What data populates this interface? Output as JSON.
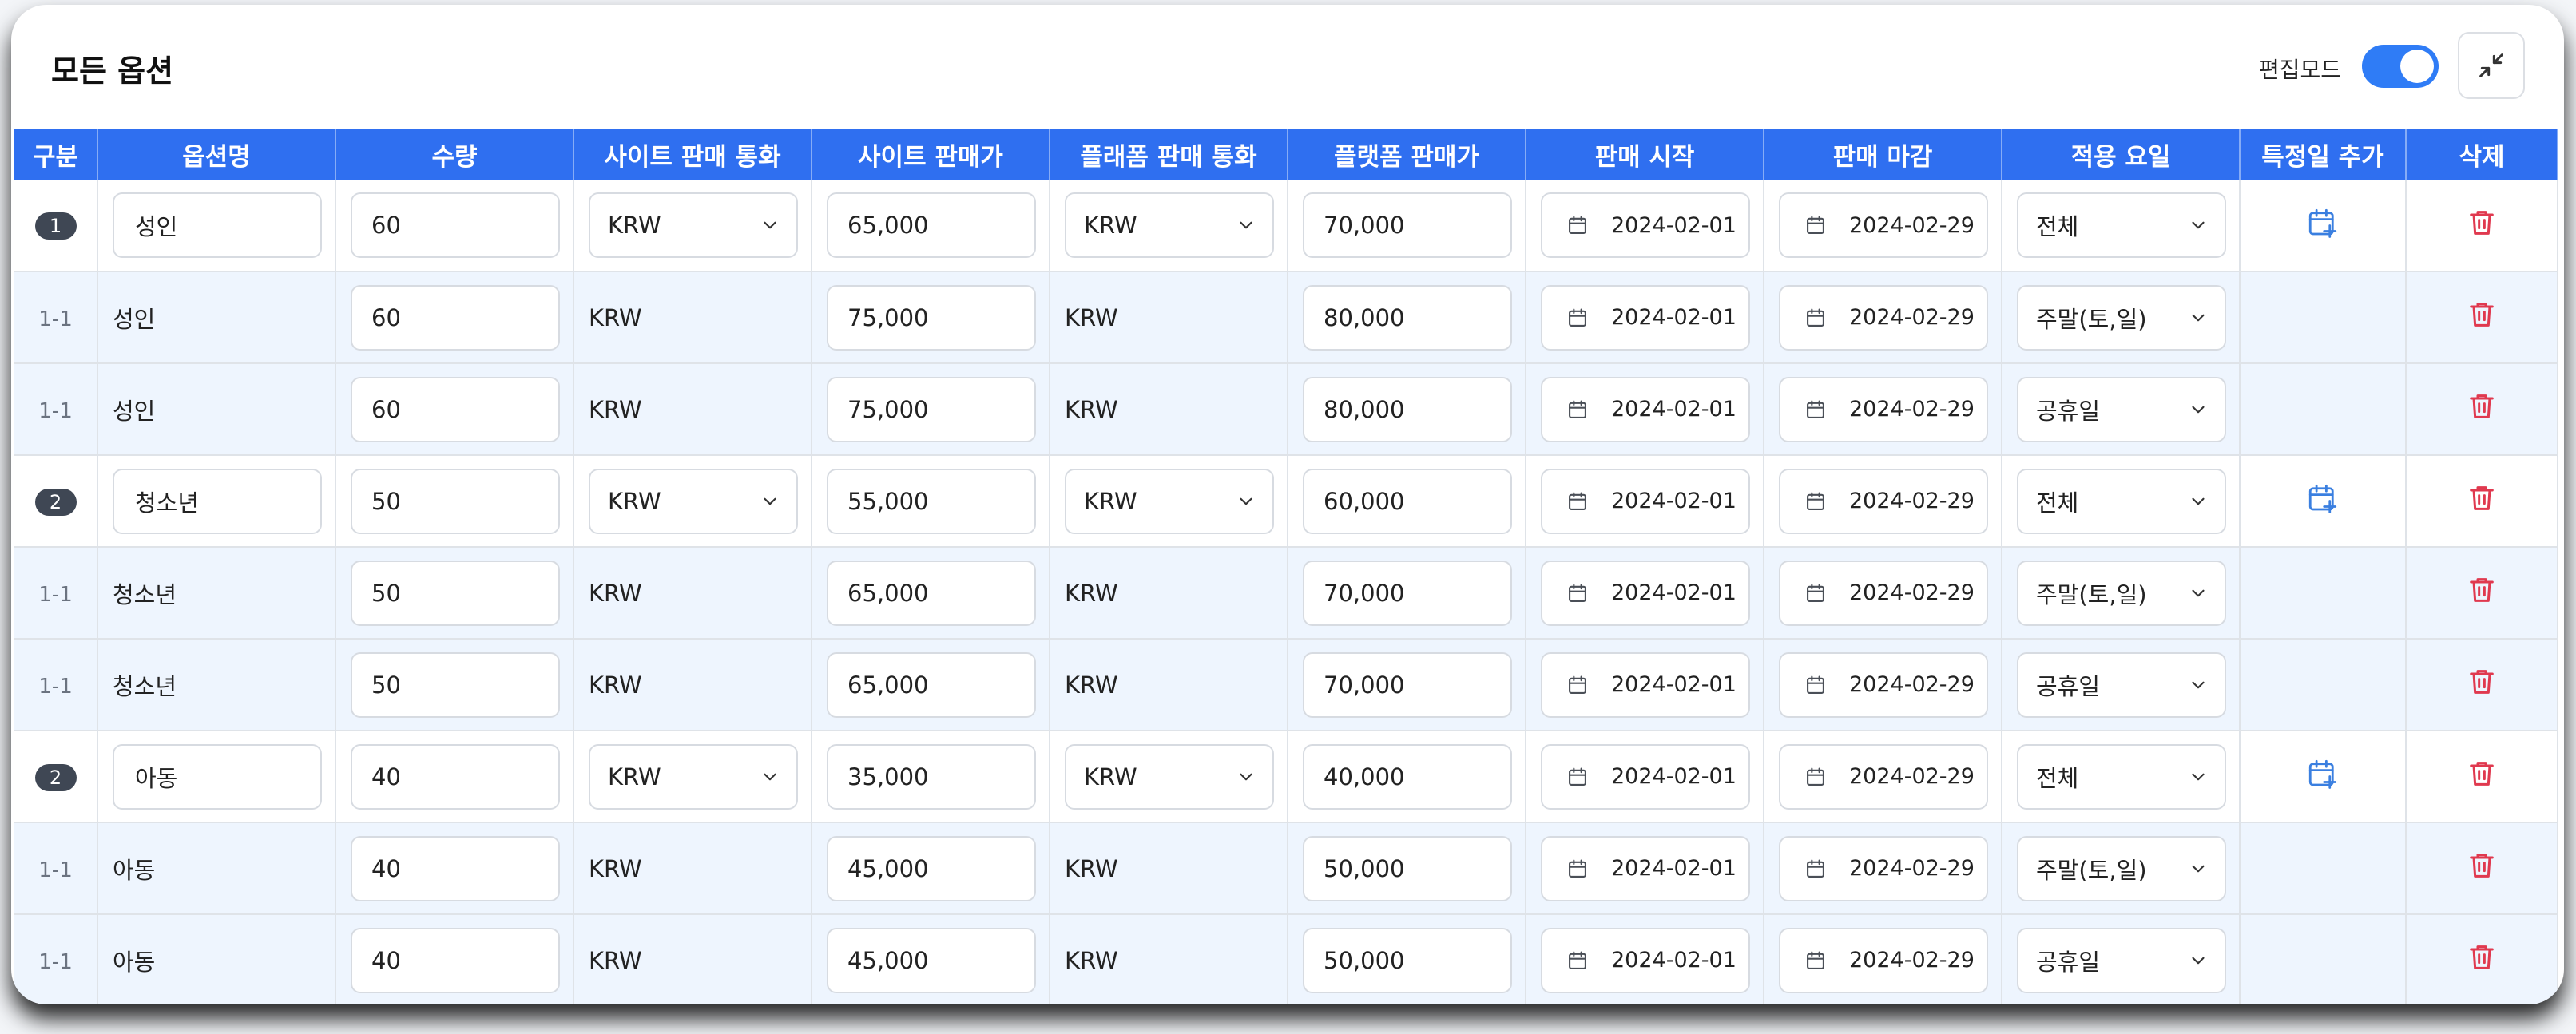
{
  "header": {
    "title": "모든 옵션",
    "edit_mode_label": "편집모드",
    "edit_mode_on": true
  },
  "colors": {
    "accent": "#2f6ff0",
    "header_bg": "#2f6ff0",
    "sub_row_bg": "#eef5fe",
    "delete_icon": "#e0394f",
    "add_date_icon": "#3a7fe0",
    "badge_bg": "#3f4754"
  },
  "icons": {
    "collapse": "minimize-arrows-icon",
    "calendar": "calendar-icon",
    "add_date": "calendar-plus-icon",
    "delete": "trash-icon",
    "dropdown": "chevron-down-icon"
  },
  "columns": [
    "구분",
    "옵션명",
    "수량",
    "사이트 판매 통화",
    "사이트 판매가",
    "플래폼 판매 통화",
    "플랫폼 판매가",
    "판매 시작",
    "판매 마감",
    "적용 요일",
    "특정일 추가",
    "삭제"
  ],
  "rows": [
    {
      "type": "main",
      "idx": "1",
      "name": "성인",
      "qty": "60",
      "site_currency": "KRW",
      "site_price": "65,000",
      "platform_currency": "KRW",
      "platform_price": "70,000",
      "start": "2024-02-01",
      "end": "2024-02-29",
      "days": "전체"
    },
    {
      "type": "sub",
      "idx": "1-1",
      "name": "성인",
      "qty": "60",
      "site_currency": "KRW",
      "site_price": "75,000",
      "platform_currency": "KRW",
      "platform_price": "80,000",
      "start": "2024-02-01",
      "end": "2024-02-29",
      "days": "주말(토,일)"
    },
    {
      "type": "sub",
      "idx": "1-1",
      "name": "성인",
      "qty": "60",
      "site_currency": "KRW",
      "site_price": "75,000",
      "platform_currency": "KRW",
      "platform_price": "80,000",
      "start": "2024-02-01",
      "end": "2024-02-29",
      "days": "공휴일"
    },
    {
      "type": "main",
      "idx": "2",
      "name": "청소년",
      "qty": "50",
      "site_currency": "KRW",
      "site_price": "55,000",
      "platform_currency": "KRW",
      "platform_price": "60,000",
      "start": "2024-02-01",
      "end": "2024-02-29",
      "days": "전체"
    },
    {
      "type": "sub",
      "idx": "1-1",
      "name": "청소년",
      "qty": "50",
      "site_currency": "KRW",
      "site_price": "65,000",
      "platform_currency": "KRW",
      "platform_price": "70,000",
      "start": "2024-02-01",
      "end": "2024-02-29",
      "days": "주말(토,일)"
    },
    {
      "type": "sub",
      "idx": "1-1",
      "name": "청소년",
      "qty": "50",
      "site_currency": "KRW",
      "site_price": "65,000",
      "platform_currency": "KRW",
      "platform_price": "70,000",
      "start": "2024-02-01",
      "end": "2024-02-29",
      "days": "공휴일"
    },
    {
      "type": "main",
      "idx": "2",
      "name": "아동",
      "qty": "40",
      "site_currency": "KRW",
      "site_price": "35,000",
      "platform_currency": "KRW",
      "platform_price": "40,000",
      "start": "2024-02-01",
      "end": "2024-02-29",
      "days": "전체"
    },
    {
      "type": "sub",
      "idx": "1-1",
      "name": "아동",
      "qty": "40",
      "site_currency": "KRW",
      "site_price": "45,000",
      "platform_currency": "KRW",
      "platform_price": "50,000",
      "start": "2024-02-01",
      "end": "2024-02-29",
      "days": "주말(토,일)"
    },
    {
      "type": "sub",
      "idx": "1-1",
      "name": "아동",
      "qty": "40",
      "site_currency": "KRW",
      "site_price": "45,000",
      "platform_currency": "KRW",
      "platform_price": "50,000",
      "start": "2024-02-01",
      "end": "2024-02-29",
      "days": "공휴일"
    }
  ]
}
